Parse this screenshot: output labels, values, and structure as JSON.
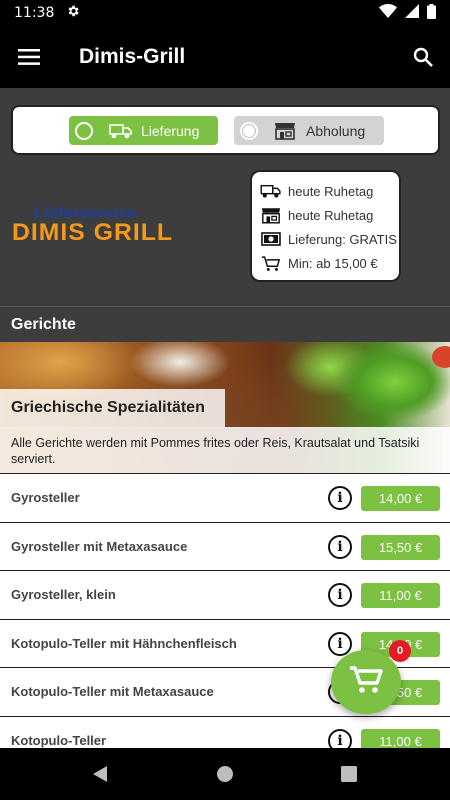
{
  "status_bar": {
    "time": "11:38"
  },
  "app_bar": {
    "title": "Dimis-Grill"
  },
  "order_mode": {
    "delivery_label": "Lieferung",
    "pickup_label": "Abholung",
    "selected": "delivery"
  },
  "logo": {
    "line1": "Lieferservice",
    "line2": "DIMIS GRILL"
  },
  "info": {
    "delivery_hours": "heute Ruhetag",
    "pickup_hours": "heute Ruhetag",
    "delivery_fee": "Lieferung: GRATIS",
    "minimum_order": "Min: ab 15,00 €"
  },
  "section": {
    "title": "Gerichte"
  },
  "category": {
    "title": "Griechische Spezialitäten",
    "description": "Alle Gerichte werden mit Pommes frites oder Reis, Krautsalat und Tsatsiki serviert."
  },
  "items": [
    {
      "name": "Gyrosteller",
      "price": "14,00 €"
    },
    {
      "name": "Gyrosteller mit Metaxasauce",
      "price": "15,50 €"
    },
    {
      "name": "Gyrosteller, klein",
      "price": "11,00 €"
    },
    {
      "name": "Kotopulo-Teller mit Hähnchenfleisch",
      "price": "14,00 €"
    },
    {
      "name": "Kotopulo-Teller mit Metaxasauce",
      "price": "15,50 €"
    },
    {
      "name": "Kotopulo-Teller",
      "price": "11,00 €"
    }
  ],
  "cart": {
    "count": "0"
  },
  "colors": {
    "accent": "#7cc142",
    "header_bg": "#3d3d3d",
    "badge": "#e41b23"
  }
}
